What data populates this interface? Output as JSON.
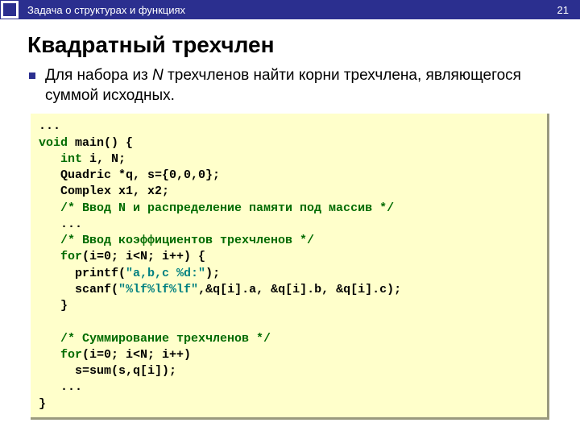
{
  "header": {
    "topic": "Задача о структурах и функциях",
    "page_number": "21"
  },
  "title": "Квадратный трехчлен",
  "bullet": {
    "prefix": "Для набора из ",
    "n": "N",
    "rest": " трехчленов найти корни трехчлена, являющегося суммой исходных."
  },
  "code": {
    "l01": "...",
    "l02a": "void",
    "l02b": " main() {",
    "l03a": "   ",
    "l03b": "int",
    "l03c": " i, N;",
    "l04": "   Quadric *q, s={0,0,0};",
    "l05": "   Complex x1, x2;",
    "l06": "   /* Ввод N и распределение памяти под массив */",
    "l07": "   ...",
    "l08": "   /* Ввод коэффициентов трехчленов */",
    "l09a": "   ",
    "l09b": "for",
    "l09c": "(i=0; i<N; i++) {",
    "l10a": "     printf(",
    "l10b": "\"a,b,c %d:\"",
    "l10c": ");",
    "l11a": "     scanf(",
    "l11b": "\"%lf%lf%lf\"",
    "l11c": ",&q[i].a, &q[i].b, &q[i].c);",
    "l12": "   }",
    "blank": "",
    "l13": "   /* Суммирование трехчленов */",
    "l14a": "   ",
    "l14b": "for",
    "l14c": "(i=0; i<N; i++)",
    "l15": "     s=sum(s,q[i]);",
    "l16": "   ...",
    "l17": "}"
  }
}
